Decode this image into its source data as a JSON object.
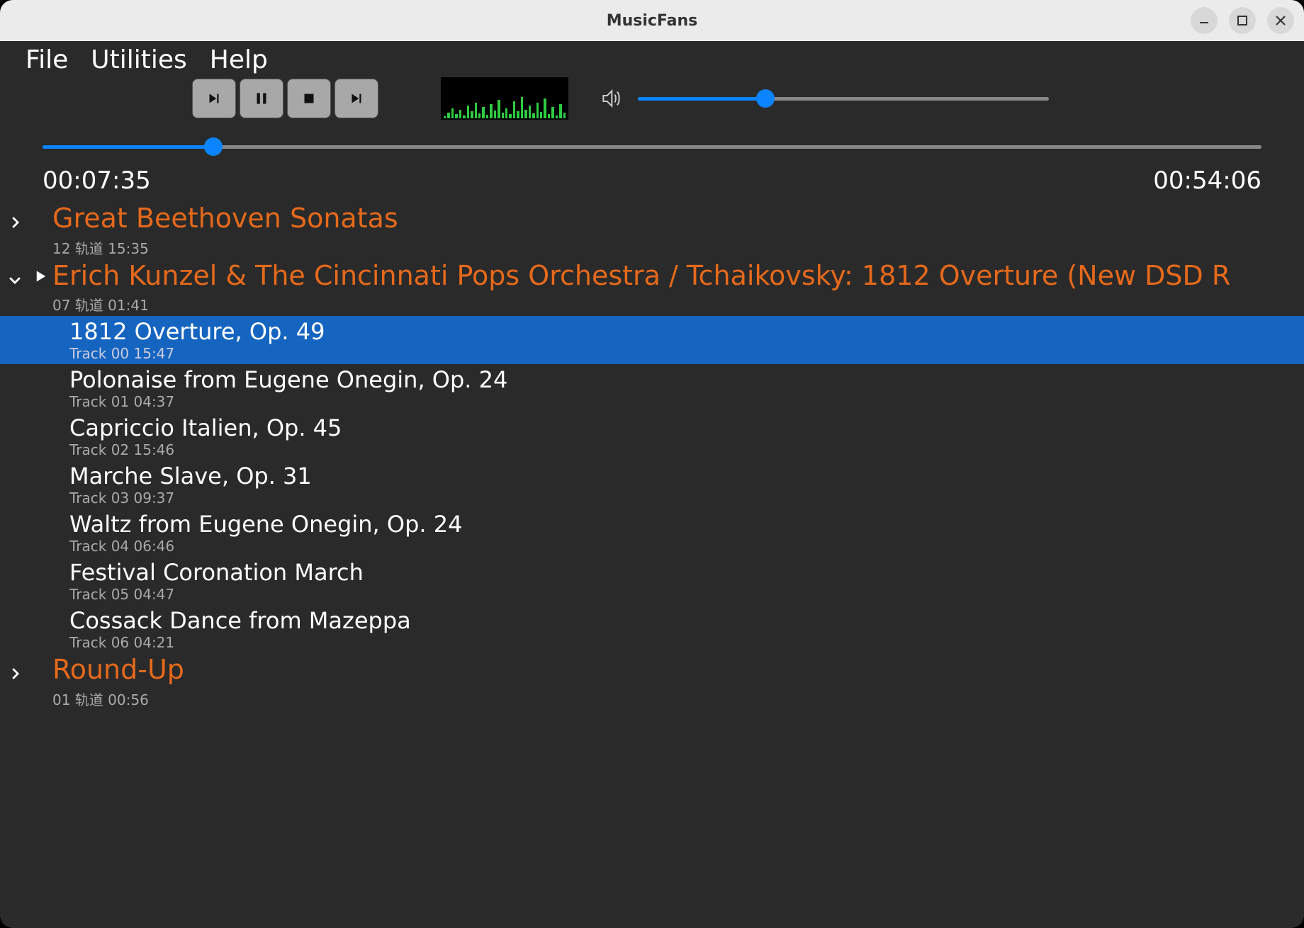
{
  "window": {
    "title": "MusicFans"
  },
  "menu": {
    "file": "File",
    "utilities": "Utilities",
    "help": "Help"
  },
  "playback": {
    "elapsed": "00:07:35",
    "total": "00:54:06",
    "seek_percent": 14,
    "volume_percent": 31
  },
  "albums": [
    {
      "title": "Great Beethoven Sonatas",
      "subtitle": "12 轨道  15:35",
      "expanded": false,
      "playing": false
    },
    {
      "title": "Erich Kunzel & The Cincinnati Pops Orchestra / Tchaikovsky: 1812 Overture (New DSD R",
      "subtitle": "07 轨道  01:41",
      "expanded": true,
      "playing": true,
      "tracks": [
        {
          "title": "1812 Overture, Op. 49",
          "subtitle": "Track 00  15:47",
          "selected": true
        },
        {
          "title": "Polonaise from Eugene Onegin, Op. 24",
          "subtitle": "Track 01  04:37",
          "selected": false
        },
        {
          "title": "Capriccio Italien, Op. 45",
          "subtitle": "Track 02  15:46",
          "selected": false
        },
        {
          "title": "Marche Slave, Op. 31",
          "subtitle": "Track 03  09:37",
          "selected": false
        },
        {
          "title": "Waltz from Eugene Onegin, Op. 24",
          "subtitle": "Track 04  06:46",
          "selected": false
        },
        {
          "title": "Festival Coronation March",
          "subtitle": "Track 05  04:47",
          "selected": false
        },
        {
          "title": "Cossack Dance from Mazeppa",
          "subtitle": "Track 06  04:21",
          "selected": false
        }
      ]
    },
    {
      "title": "Round-Up",
      "subtitle": "01 轨道  00:56",
      "expanded": false,
      "playing": false
    }
  ],
  "visualizer_bars": [
    3,
    8,
    14,
    6,
    12,
    4,
    18,
    10,
    22,
    7,
    16,
    5,
    20,
    11,
    26,
    8,
    14,
    6,
    24,
    10,
    30,
    12,
    18,
    7,
    22,
    9,
    28,
    6,
    16,
    4,
    20,
    8
  ],
  "colors": {
    "accent": "#e6691b",
    "selection": "#1565c0",
    "slider": "#0b84ff"
  }
}
